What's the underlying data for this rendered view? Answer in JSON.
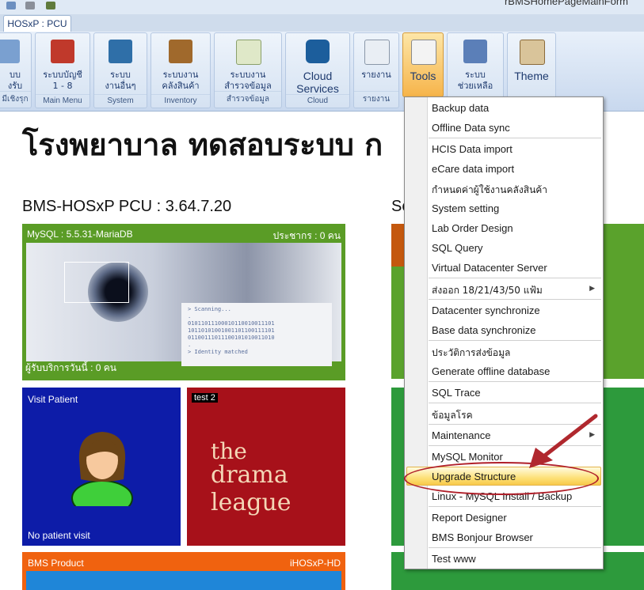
{
  "window": {
    "title": "rBMSHomePageMainForm"
  },
  "tab": {
    "label": "HOSxP : PCU"
  },
  "ribbon": {
    "groups": [
      {
        "label": "บบ\nงรับ",
        "caption": "มีเชิงรุก"
      },
      {
        "label": "ระบบบัญชี\n1 - 8",
        "caption": "Main Menu"
      },
      {
        "label": "ระบบ\nงานอื่นๆ",
        "caption": "System"
      },
      {
        "label": "ระบบงาน\nคลังสินค้า",
        "caption": "Inventory"
      },
      {
        "label": "ระบบงาน\nสำรวจข้อมูล",
        "caption": "สำรวจข้อมูล"
      },
      {
        "label": "Cloud\nServices",
        "caption": "Cloud"
      },
      {
        "label": "รายงาน",
        "caption": "รายงาน"
      },
      {
        "label": "Tools",
        "caption": ""
      },
      {
        "label": "ระบบ\nช่วยเหลือ",
        "caption": ""
      },
      {
        "label": "Theme",
        "caption": ""
      }
    ]
  },
  "page": {
    "hospital_name": "โรงพยาบาล ทดสอบระบบ ก",
    "version": "BMS-HOSxP PCU : 3.64.7.20",
    "right_heading": "Se"
  },
  "tiles": {
    "mysql": {
      "left": "MySQL : 5.5.31-MariaDB",
      "right": "ประชากร : 0 คน",
      "bottom": "ผู้รับบริการวันนี้ : 0 คน",
      "scan_text": "> Scanning...\n.\n01011011100010110010011101\n10110101001001101100111101\n01100111011100101010011010\n.\n> Identity matched"
    },
    "visit": {
      "title": "Visit Patient",
      "bottom": "No patient visit"
    },
    "test": {
      "title": "test 2",
      "logo_word1": "the",
      "logo_word2": "drama league"
    },
    "bms": {
      "title": "BMS Product",
      "right": "iHOSxP-HD"
    }
  },
  "menu": {
    "items": [
      "Backup data",
      "Offline Data sync",
      "HCIS Data import",
      "eCare data import",
      "กำหนดค่าผู้ใช้งานคลังสินค้า",
      "System setting",
      "Lab Order Design",
      "SQL Query",
      "Virtual Datacenter Server",
      "ส่งออก 18/21/43/50 แฟ้ม",
      "Datacenter synchronize",
      "Base data synchronize",
      "ประวัติการส่งข้อมูล",
      "Generate offline database",
      "SQL Trace",
      "ข้อมูลโรค",
      "Maintenance",
      "MySQL Monitor",
      "Upgrade Structure",
      "Linux - MySQL Install / Backup",
      "Report Designer",
      "BMS Bonjour Browser",
      "Test www"
    ]
  },
  "colors": {
    "ribbon_accent": "#1e3a6e",
    "active_tab": "#f6b44a",
    "highlight_ring": "#b0202a",
    "tile_green": "#5a9c26",
    "tile_blue": "#0d1ca8",
    "tile_red": "#a7111a",
    "tile_orange": "#f0620f"
  }
}
